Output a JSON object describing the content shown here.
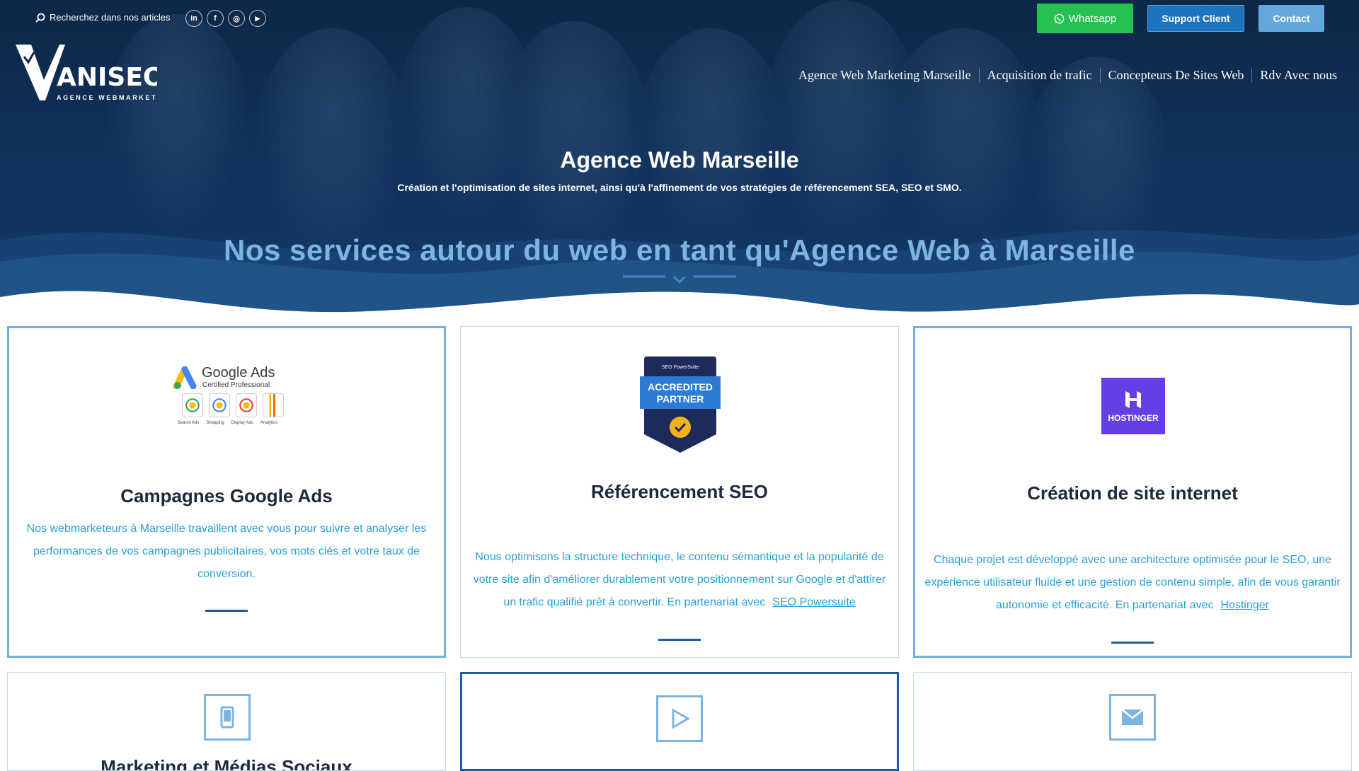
{
  "topbar": {
    "search_label": "Recherchez dans nos articles",
    "socials": [
      {
        "icon": "linkedin-icon",
        "glyph": "in"
      },
      {
        "icon": "facebook-icon",
        "glyph": "f"
      },
      {
        "icon": "instagram-icon",
        "glyph": "◎"
      },
      {
        "icon": "youtube-icon",
        "glyph": "▶"
      }
    ],
    "whatsapp_label": "Whatsapp",
    "support_label": "Support Client",
    "contact_label": "Contact"
  },
  "logo": {
    "name": "VANISEO",
    "tagline": "AGENCE WEBMARKETING"
  },
  "nav": {
    "items": [
      "Agence Web Marketing Marseille",
      "Acquisition de trafic",
      "Concepteurs De Sites Web",
      "Rdv Avec nous"
    ]
  },
  "hero": {
    "title": "Agence Web Marseille",
    "subtitle": "Création et l'optimisation de sites internet, ainsi qu'à l'affinement de vos stratégies de référencement SEA, SEO et SMO.",
    "services_title": "Nos services autour du web en tant qu'Agence Web à Marseille"
  },
  "cards": [
    {
      "title": "Campagnes Google Ads",
      "text": "Nos webmarketeurs à Marseille travaillent avec vous pour suivre et analyser les performances de vos campagnes publicitaires, vos mots clés et votre taux de conversion.",
      "badge": {
        "brand": "Google Ads",
        "sub": "Certified Professional",
        "items": [
          "Search Ads",
          "Shopping",
          "Display Ads",
          "Analytics"
        ]
      }
    },
    {
      "title": "Référencement SEO",
      "text": "Nous optimisons la structure technique, le contenu sémantique et la popularité de votre site afin d'améliorer durablement votre positionnement sur Google et d'attirer un trafic qualifié prêt à convertir. En partenariat avec",
      "link": "SEO Powersuite",
      "badge": {
        "top": "SEO PowerSuite",
        "line1": "ACCREDITED",
        "line2": "PARTNER"
      }
    },
    {
      "title": "Création de site internet",
      "text": "Chaque projet est développé avec une architecture optimisée pour le SEO, une expérience utilisateur fluide et une gestion de contenu simple, afin de vous garantir autonomie et efficacité. En partenariat avec",
      "link": "Hostinger",
      "badge": {
        "label": "HOSTINGER"
      }
    },
    {
      "title": "Marketing et Médias Sociaux",
      "icon": "smartphone-icon"
    },
    {
      "icon": "play-icon"
    },
    {
      "icon": "envelope-icon"
    }
  ],
  "colors": {
    "hero_bg": "#10305a",
    "accent_light": "#7eb4e2",
    "text_link": "#29a0d8",
    "whatsapp": "#25c052",
    "support": "#1e73be",
    "contact": "#63a8dc"
  }
}
